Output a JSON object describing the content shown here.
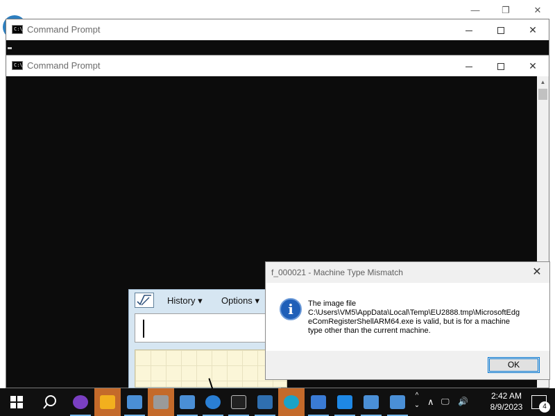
{
  "background_window": {
    "minimize": "—",
    "maximize": "❐",
    "close": "✕"
  },
  "cmd_windows": [
    {
      "title": "Command Prompt",
      "icon_text": "C:\\_",
      "minimize": "—",
      "close": "✕"
    },
    {
      "title": "Command Prompt",
      "icon_text": "C:\\_",
      "minimize": "—",
      "close": "✕"
    }
  ],
  "math_panel": {
    "menu": [
      {
        "label": "History",
        "arrow": "▾"
      },
      {
        "label": "Options",
        "arrow": "▾"
      }
    ]
  },
  "dialog": {
    "title": "f_000021 - Machine Type Mismatch",
    "close": "✕",
    "icon_glyph": "i",
    "message_lines": [
      "The image file",
      "C:\\Users\\VM5\\AppData\\Local\\Temp\\EU2888.tmp\\MicrosoftEdg",
      "eComRegisterShellARM64.exe is valid, but is for a machine",
      "type other than the current machine."
    ],
    "ok_label": "OK"
  },
  "taskbar": {
    "icons": [
      {
        "name": "start-icon",
        "color": "#ffffff"
      },
      {
        "name": "search-icon",
        "color": "#ffffff"
      },
      {
        "name": "app-mask-icon",
        "color": "#7a3fc2"
      },
      {
        "name": "shield-icon",
        "color": "#f2b01e"
      },
      {
        "name": "setup-icon",
        "color": "#4a8fd6"
      },
      {
        "name": "printer-icon",
        "color": "#9a9a9a"
      },
      {
        "name": "setup-icon-2",
        "color": "#4a8fd6"
      },
      {
        "name": "internet-explorer-icon",
        "color": "#2a7fd4"
      },
      {
        "name": "command-prompt-icon",
        "color": "#222222"
      },
      {
        "name": "news-icon",
        "color": "#2f6fb0"
      },
      {
        "name": "edge-icon",
        "color": "#1aa3c8"
      },
      {
        "name": "image-viewer-icon",
        "color": "#3a7bd5"
      },
      {
        "name": "window-app-icon",
        "color": "#1e88e5"
      },
      {
        "name": "setup-icon-3",
        "color": "#4a8fd6"
      },
      {
        "name": "setup-icon-4",
        "color": "#4a8fd6"
      }
    ],
    "overflow_arrow": "⌄",
    "tray_chevron": "∧",
    "network_icon": "🖵",
    "volume_icon": "🔊",
    "time": "2:42 AM",
    "date": "8/9/2023",
    "notification_count": "4"
  }
}
